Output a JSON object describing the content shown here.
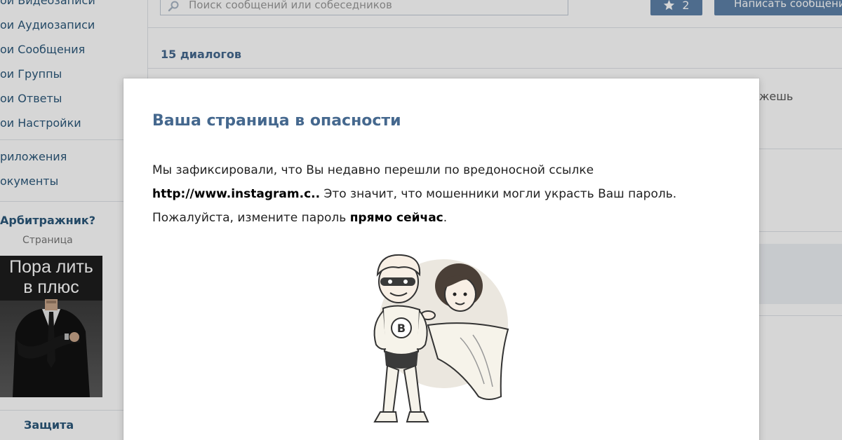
{
  "left_menu": {
    "items": [
      {
        "label": "ои Видеозаписи"
      },
      {
        "label": "ои Аудиозаписи"
      },
      {
        "label": "ои Сообщения"
      },
      {
        "label": "ои Группы"
      },
      {
        "label": "ои Ответы"
      },
      {
        "label": "ои Настройки"
      },
      {
        "label": "риложения"
      },
      {
        "label": "окументы"
      }
    ],
    "ad": {
      "title": "Арбитражник?",
      "subtitle": "Страница",
      "banner_line1": "Пора лить",
      "banner_line2": "в плюс"
    },
    "protect_label": "Защита"
  },
  "header": {
    "search_placeholder": "Поиск сообщений или собеседников",
    "favorites_count": "2",
    "write_button_label": "Написать сообщение"
  },
  "dialogs": {
    "count_label": "15 диалогов",
    "partial_text": "жешь"
  },
  "modal": {
    "title": "Ваша страница в опасности",
    "text_part1": "Мы зафиксировали, что Вы недавно перешли по вредоносной ссылке",
    "link": "http://www.instagram.c..",
    "text_part2": " Это значит, что мошенники могли украсть Ваш пароль. Пожалуйста, измените пароль ",
    "emphasis": "прямо сейчас",
    "text_end": "."
  },
  "colors": {
    "accent": "#45688e",
    "link": "#2b587a",
    "button": "#5e81a8"
  },
  "icons": {
    "search": "search-icon",
    "favorites": "star-icon"
  }
}
